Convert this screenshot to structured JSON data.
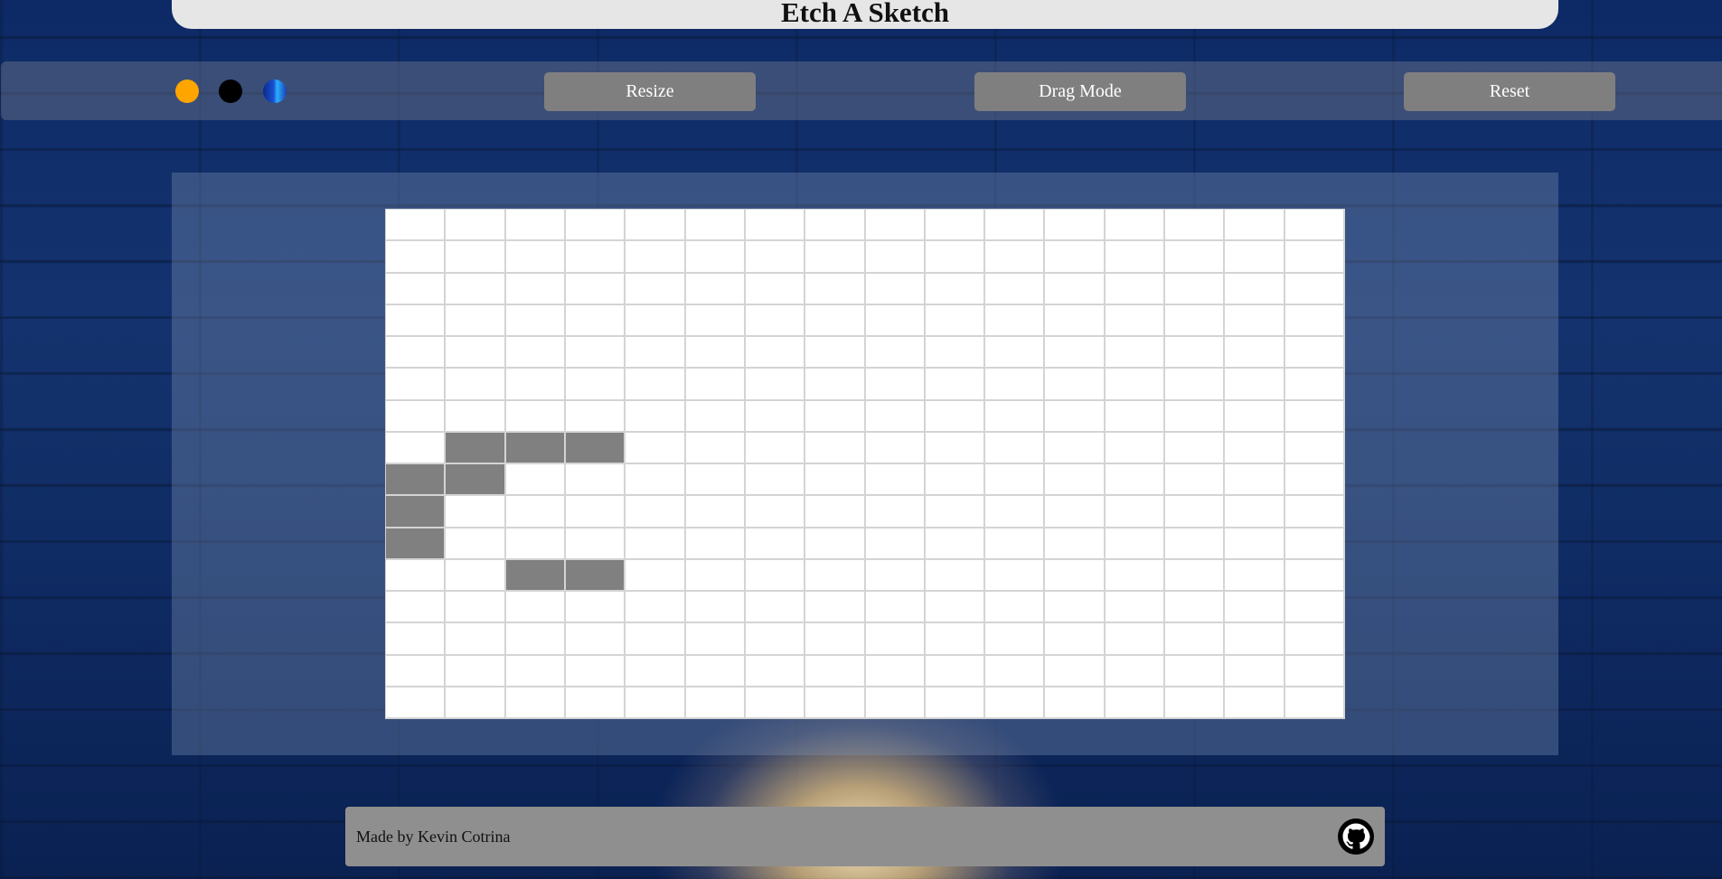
{
  "header": {
    "title": "Etch A Sketch"
  },
  "toolbar": {
    "colors": [
      {
        "name": "orange-color",
        "color": "#ffa500"
      },
      {
        "name": "black-color",
        "color": "#000000"
      },
      {
        "name": "rainbow-color",
        "color": "gradient"
      }
    ],
    "resize_label": "Resize",
    "drag_label": "Drag Mode",
    "reset_label": "Reset"
  },
  "grid": {
    "size": 16,
    "fill_color": "#808080",
    "filled_cells": [
      [
        7,
        1
      ],
      [
        7,
        2
      ],
      [
        7,
        3
      ],
      [
        8,
        0
      ],
      [
        8,
        1
      ],
      [
        9,
        0
      ],
      [
        10,
        0
      ],
      [
        11,
        2
      ],
      [
        11,
        3
      ]
    ]
  },
  "footer": {
    "credit": "Made by Kevin Cotrina",
    "icon": "github-icon"
  }
}
